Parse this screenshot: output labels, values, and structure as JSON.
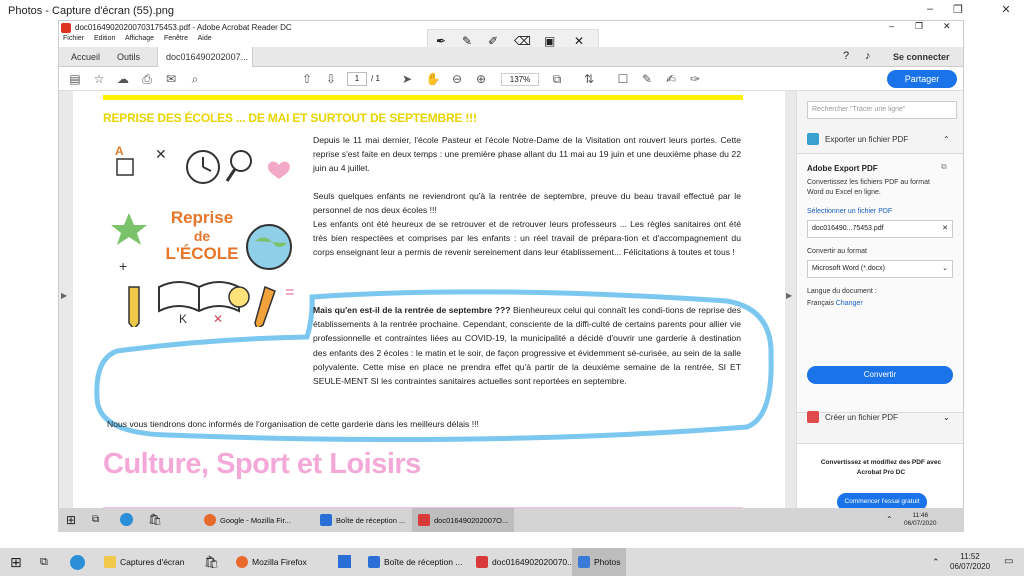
{
  "photos": {
    "title": "Photos - Capture d'écran (55).png"
  },
  "acrobat": {
    "title": "doc01649020200703175453.pdf - Adobe Acrobat Reader DC",
    "menu": [
      "Fichier",
      "Edition",
      "Affichage",
      "Fenêtre",
      "Aide"
    ],
    "tabs": {
      "home": "Accueil",
      "tools": "Outils",
      "doc": "doc016490202007..."
    },
    "signin": "Se connecter",
    "page_current": "1",
    "page_total": "/ 1",
    "zoom": "137%",
    "share": "Partager"
  },
  "document": {
    "heading1": "REPRISE DES ÉCOLES ... DE MAI  ET SURTOUT DE SEPTEMBRE !!!",
    "badge": {
      "line1": "Reprise",
      "line2": "de",
      "line3": "L'ÉCOLE"
    },
    "para1": "Depuis le 11 mai dernier, l'école Pasteur et l'école Notre-Dame de la Visitation ont rouvert leurs portes. Cette reprise s'est faite en deux temps : une première phase allant du 11 mai au 19 juin et une deuxième phase du 22 juin au 4 juillet.",
    "para2": "Seuls quelques enfants ne reviendront qu'à la rentrée de septembre, preuve du beau travail effectué par le personnel de nos deux écoles !!!",
    "para3": "Les enfants ont été heureux de se retrouver et de retrouver leurs professeurs ... Les règles sanitaires ont été très bien respectées et comprises par les enfants : un réel travail de prépara-tion et d'accompagnement du corps enseignant leur a permis de revenir sereinement dans leur établissement... Félicitations à toutes et tous !",
    "para4_bold": "Mais qu'en est-il de la rentrée de septembre ???",
    "para4": " Bienheureux celui qui connaît les condi-tions de reprise des établissements à la rentrée prochaine.  Cependant, consciente de la diffi-culté de certains parents pour allier vie professionnelle et contraintes liées au COVID-19, la municipalité a décidé d'ouvrir une garderie à destination des enfants des 2 écoles : le matin et le soir, de façon progressive et évidemment sé-curisée, au sein de la salle polyvalente. Cette mise en place ne prendra effet qu'à partir de la deuxième semaine de la rentrée, SI ET SEULE-MENT SI les contraintes sanitaires actuelles sont reportées en septembre.",
    "para5": "Nous vous tiendrons donc informés de l'organisation de cette garderie dans les meilleurs délais  !!!",
    "heading2": "Culture, Sport et Loisirs"
  },
  "sidepanel": {
    "search_placeholder": "Rechercher \"Tracer une ligne\"",
    "export_title": "Exporter un fichier PDF",
    "export_heading": "Adobe Export PDF",
    "export_desc": "Convertissez les fichiers PDF au format Word ou Excel en ligne.",
    "select_file": "Sélectionner un fichier PDF",
    "file_name": "doc016490...75453.pdf",
    "convert_to": "Convertir au format",
    "format": "Microsoft Word (*.docx)",
    "lang_label": "Langue du document :",
    "lang_value": "Français",
    "lang_change": "Changer",
    "convert_btn": "Convertir",
    "create_pdf": "Créer un fichier PDF",
    "promo": "Convertissez et modifiez des PDF avec Acrobat Pro DC",
    "trial_btn": "Commencer l'essai gratuit"
  },
  "inner_taskbar": {
    "items": [
      "Google - Mozilla Fir...",
      "Boîte de réception ...",
      "doc016490202007O..."
    ],
    "time": "11:46",
    "date": "06/07/2020"
  },
  "outer_taskbar": {
    "items": [
      "Captures d'écran",
      "Mozilla Firefox",
      "Boîte de réception ...",
      "doc0164902020070...",
      "Photos"
    ],
    "time": "11:52",
    "date": "06/07/2020"
  },
  "colors": {
    "accent": "#1a73e8",
    "heading_yellow": "#e8d400",
    "heading_pink": "#f4a8d8",
    "highlight_blue": "#7cc7f0"
  }
}
